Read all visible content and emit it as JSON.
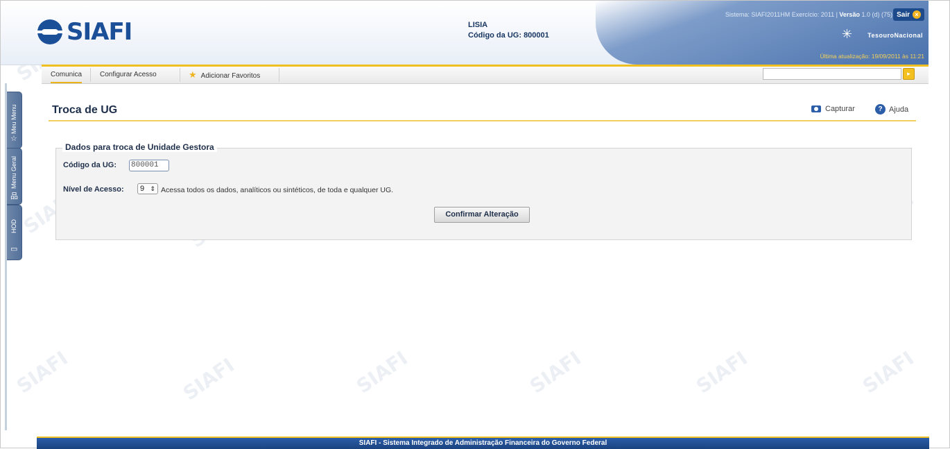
{
  "header": {
    "logo_text": "SIAFI",
    "user_name": "LISIA",
    "ug_label": "Código da UG:",
    "ug_code": "800001",
    "system_info": "Sistema: SIAFI2011HM Exercício: 2011",
    "version_label": "Versão",
    "version_value": "1.0 (d) (75)",
    "logout_label": "Sair",
    "tesouro_label": "TesouroNacional",
    "last_update": "Última atualização: 19/09/2011 às 11:21"
  },
  "menu": {
    "items": [
      {
        "label": "Comunica"
      },
      {
        "label": "Configurar Acesso"
      },
      {
        "label": "Adicionar Favoritos"
      }
    ],
    "search_value": ""
  },
  "side_tabs": [
    {
      "label": "Meu Menu",
      "icon": "star-icon"
    },
    {
      "label": "Menu Geral",
      "icon": "sitemap-icon"
    },
    {
      "label": "HOD",
      "icon": "monitor-icon"
    }
  ],
  "page": {
    "title": "Troca de UG",
    "capture_label": "Capturar",
    "help_label": "Ajuda"
  },
  "form": {
    "legend": "Dados para troca de Unidade Gestora",
    "ug_label": "Código da UG:",
    "ug_value": "800001",
    "level_label": "Nível de Acesso:",
    "level_value": "9",
    "level_description": "Acessa todos os dados, analíticos ou sintéticos, de toda e qualquer UG.",
    "confirm_label": "Confirmar Alteração"
  },
  "footer": {
    "text": "SIAFI - Sistema Integrado de Administração Financeira do Governo Federal"
  },
  "colors": {
    "brand_blue": "#1b4f98",
    "accent_yellow": "#f0c020",
    "footer_blue": "#2b5da8"
  }
}
